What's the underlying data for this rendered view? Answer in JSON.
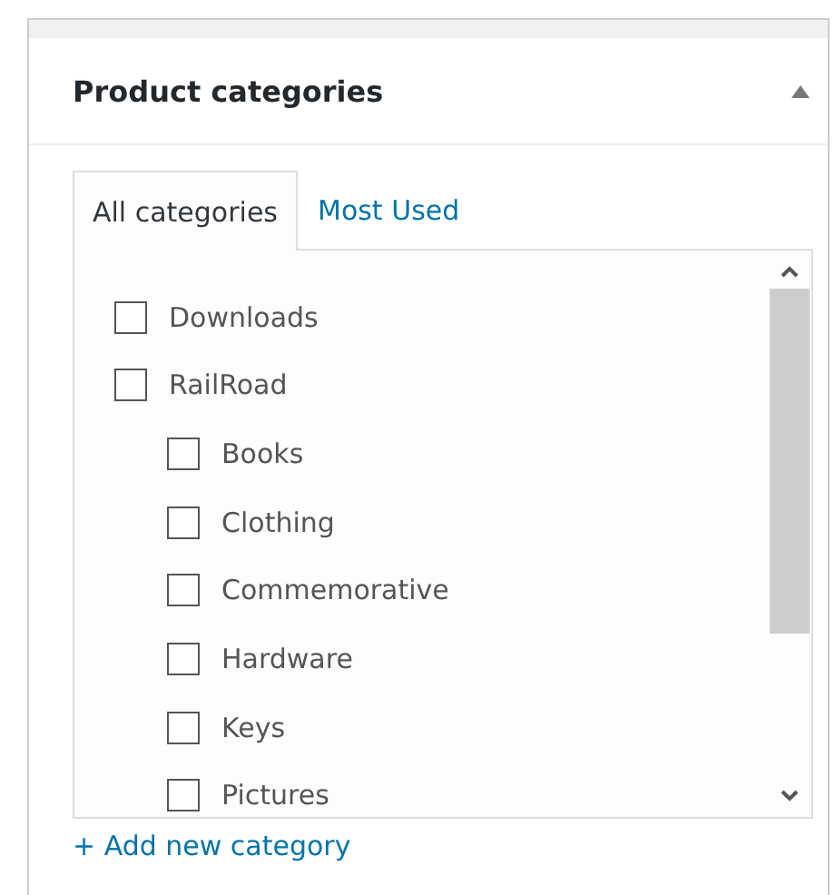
{
  "panel": {
    "title": "Product categories",
    "collapsed": false
  },
  "tabs": [
    {
      "label": "All categories",
      "selected": true
    },
    {
      "label": "Most Used",
      "selected": false
    }
  ],
  "categories": [
    {
      "label": "Downloads",
      "checked": false
    },
    {
      "label": "RailRoad",
      "checked": false,
      "children": [
        {
          "label": "Books",
          "checked": false
        },
        {
          "label": "Clothing",
          "checked": false
        },
        {
          "label": "Commemorative",
          "checked": false
        },
        {
          "label": "Hardware",
          "checked": false
        },
        {
          "label": "Keys",
          "checked": false
        },
        {
          "label": "Pictures",
          "checked": false
        }
      ]
    }
  ],
  "add_link": "+ Add new category"
}
